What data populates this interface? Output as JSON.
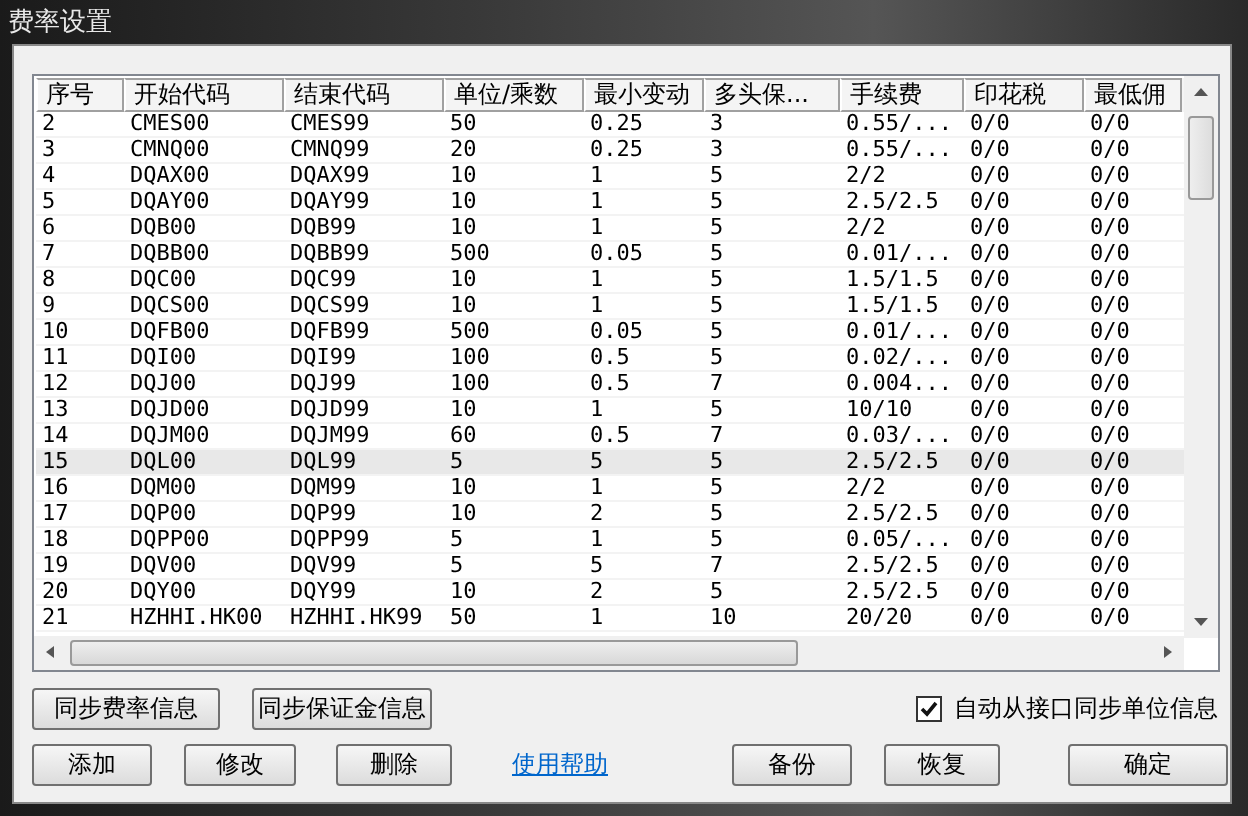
{
  "window": {
    "title": "费率设置"
  },
  "table": {
    "columns": [
      "序号",
      "开始代码",
      "结束代码",
      "单位/乘数",
      "最小变动",
      "多头保...",
      "手续费",
      "印花税",
      "最低佣"
    ],
    "rows": [
      {
        "cells": [
          "2",
          "CMES00",
          "CMES99",
          "50",
          "0.25",
          "3",
          "0.55/...",
          "0/0",
          "0/0"
        ],
        "selected": false
      },
      {
        "cells": [
          "3",
          "CMNQ00",
          "CMNQ99",
          "20",
          "0.25",
          "3",
          "0.55/...",
          "0/0",
          "0/0"
        ],
        "selected": false
      },
      {
        "cells": [
          "4",
          "DQAX00",
          "DQAX99",
          "10",
          "1",
          "5",
          "2/2",
          "0/0",
          "0/0"
        ],
        "selected": false
      },
      {
        "cells": [
          "5",
          "DQAY00",
          "DQAY99",
          "10",
          "1",
          "5",
          "2.5/2.5",
          "0/0",
          "0/0"
        ],
        "selected": false
      },
      {
        "cells": [
          "6",
          "DQB00",
          "DQB99",
          "10",
          "1",
          "5",
          "2/2",
          "0/0",
          "0/0"
        ],
        "selected": false
      },
      {
        "cells": [
          "7",
          "DQBB00",
          "DQBB99",
          "500",
          "0.05",
          "5",
          "0.01/...",
          "0/0",
          "0/0"
        ],
        "selected": false
      },
      {
        "cells": [
          "8",
          "DQC00",
          "DQC99",
          "10",
          "1",
          "5",
          "1.5/1.5",
          "0/0",
          "0/0"
        ],
        "selected": false
      },
      {
        "cells": [
          "9",
          "DQCS00",
          "DQCS99",
          "10",
          "1",
          "5",
          "1.5/1.5",
          "0/0",
          "0/0"
        ],
        "selected": false
      },
      {
        "cells": [
          "10",
          "DQFB00",
          "DQFB99",
          "500",
          "0.05",
          "5",
          "0.01/...",
          "0/0",
          "0/0"
        ],
        "selected": false
      },
      {
        "cells": [
          "11",
          "DQI00",
          "DQI99",
          "100",
          "0.5",
          "5",
          "0.02/...",
          "0/0",
          "0/0"
        ],
        "selected": false
      },
      {
        "cells": [
          "12",
          "DQJ00",
          "DQJ99",
          "100",
          "0.5",
          "7",
          "0.004...",
          "0/0",
          "0/0"
        ],
        "selected": false
      },
      {
        "cells": [
          "13",
          "DQJD00",
          "DQJD99",
          "10",
          "1",
          "5",
          "10/10",
          "0/0",
          "0/0"
        ],
        "selected": false
      },
      {
        "cells": [
          "14",
          "DQJM00",
          "DQJM99",
          "60",
          "0.5",
          "7",
          "0.03/...",
          "0/0",
          "0/0"
        ],
        "selected": false
      },
      {
        "cells": [
          "15",
          "DQL00",
          "DQL99",
          "5",
          "5",
          "5",
          "2.5/2.5",
          "0/0",
          "0/0"
        ],
        "selected": true
      },
      {
        "cells": [
          "16",
          "DQM00",
          "DQM99",
          "10",
          "1",
          "5",
          "2/2",
          "0/0",
          "0/0"
        ],
        "selected": false
      },
      {
        "cells": [
          "17",
          "DQP00",
          "DQP99",
          "10",
          "2",
          "5",
          "2.5/2.5",
          "0/0",
          "0/0"
        ],
        "selected": false
      },
      {
        "cells": [
          "18",
          "DQPP00",
          "DQPP99",
          "5",
          "1",
          "5",
          "0.05/...",
          "0/0",
          "0/0"
        ],
        "selected": false
      },
      {
        "cells": [
          "19",
          "DQV00",
          "DQV99",
          "5",
          "5",
          "7",
          "2.5/2.5",
          "0/0",
          "0/0"
        ],
        "selected": false
      },
      {
        "cells": [
          "20",
          "DQY00",
          "DQY99",
          "10",
          "2",
          "5",
          "2.5/2.5",
          "0/0",
          "0/0"
        ],
        "selected": false
      },
      {
        "cells": [
          "21",
          "HZHHI.HK00",
          "HZHHI.HK99",
          "50",
          "1",
          "10",
          "20/20",
          "0/0",
          "0/0"
        ],
        "selected": false
      }
    ]
  },
  "sync_buttons": [
    "同步费率信息",
    "同步保证金信息"
  ],
  "auto_sync": {
    "label": "自动从接口同步单位信息",
    "checked": true
  },
  "buttons": [
    {
      "kind": "button",
      "label": "添加"
    },
    {
      "kind": "button",
      "label": "修改"
    },
    {
      "kind": "button",
      "label": "删除"
    },
    {
      "kind": "link",
      "label": "使用帮助"
    },
    {
      "kind": "button",
      "label": "备份"
    },
    {
      "kind": "button",
      "label": "恢复"
    },
    {
      "kind": "button",
      "label": "确定"
    }
  ]
}
